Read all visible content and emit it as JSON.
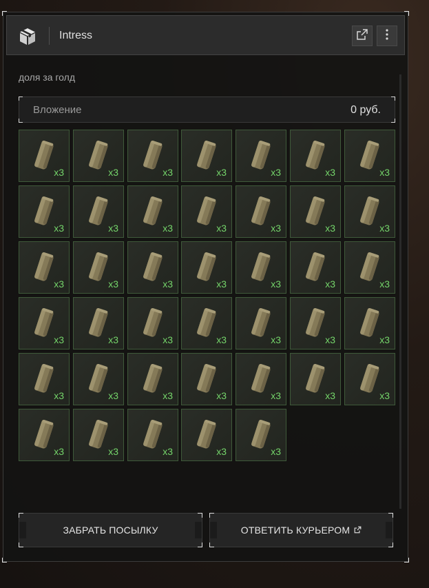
{
  "window": {
    "title": "Intress",
    "logo_icon": "package-box-icon",
    "actions": [
      {
        "name": "open-external-icon"
      },
      {
        "name": "more-vertical-icon"
      }
    ]
  },
  "subtitle": "доля за голд",
  "investment": {
    "label": "Вложение",
    "value": "0 руб."
  },
  "items": {
    "icon": "canister-item-icon",
    "rows": [
      [
        "x3",
        "x3",
        "x3",
        "x3",
        "x3",
        "x3",
        "x3"
      ],
      [
        "x3",
        "x3",
        "x3",
        "x3",
        "x3",
        "x3",
        "x3"
      ],
      [
        "x3",
        "x3",
        "x3",
        "x3",
        "x3",
        "x3",
        "x3"
      ],
      [
        "x3",
        "x3",
        "x3",
        "x3",
        "x3",
        "x3",
        "x3"
      ],
      [
        "x3",
        "x3",
        "x3",
        "x3",
        "x3",
        "x3",
        "x3"
      ],
      [
        "x3",
        "x3",
        "x3",
        "x3",
        "x3"
      ]
    ]
  },
  "buttons": {
    "take": "ЗАБРАТЬ ПОСЫЛКУ",
    "reply": "ОТВЕТИТЬ КУРЬЕРОМ",
    "reply_icon": "open-external-icon"
  },
  "colors": {
    "quantity": "#74d46a",
    "cell_border": "#3f5a3a"
  }
}
